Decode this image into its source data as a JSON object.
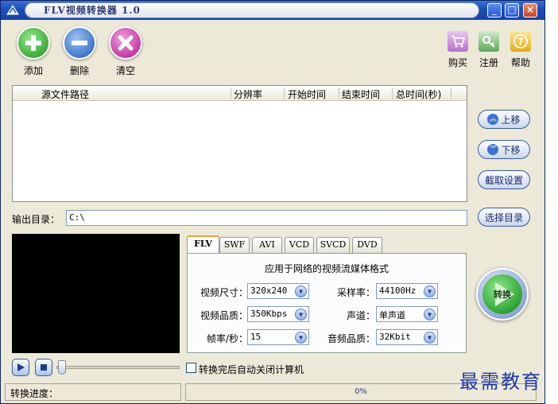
{
  "window": {
    "title": "FLV视频转换器 1.0",
    "minimize": "_",
    "maximize": "□",
    "close": "×"
  },
  "toolbar": {
    "add_label": "添加",
    "delete_label": "删除",
    "clear_label": "清空",
    "buy_label": "购买",
    "register_label": "注册",
    "help_label": "帮助"
  },
  "file_list": {
    "columns": [
      "源文件路径",
      "分辨率",
      "开始时间",
      "结束时间",
      "总时间(秒)"
    ],
    "rows": []
  },
  "side_buttons": {
    "move_up": "上移",
    "move_down": "下移",
    "capture_settings": "截取设置",
    "choose_dir": "选择目录"
  },
  "output": {
    "label": "输出目录：",
    "path": "C:\\"
  },
  "format_tabs": [
    "FLV",
    "SWF",
    "AVI",
    "VCD",
    "SVCD",
    "DVD"
  ],
  "active_tab": "FLV",
  "flv_panel": {
    "description": "应用于网络的视频流媒体格式",
    "video_size_label": "视频尺寸：",
    "video_size": "320x240",
    "video_quality_label": "视频品质：",
    "video_quality": "350Kbps",
    "frame_rate_label": "帧率/秒：",
    "frame_rate": "15",
    "sample_rate_label": "采样率：",
    "sample_rate": "44100Hz",
    "channel_label": "声道：",
    "channel": "单声道",
    "audio_quality_label": "音频品质：",
    "audio_quality": "32Kbit"
  },
  "convert": {
    "label": "转换"
  },
  "player": {
    "seek_position": 0
  },
  "shutdown_checkbox": {
    "label": "转换完后自动关闭计算机",
    "checked": false
  },
  "status": {
    "progress_label": "转换进度：",
    "progress_text": "0%",
    "progress_value": 0
  },
  "watermark": "最需教育",
  "colors": {
    "titlebar": "#1b4db8",
    "window_bg": "#ece9d8",
    "add_green": "#3fae3a",
    "delete_blue": "#3f78d0",
    "clear_magenta": "#c83aa6",
    "convert_green": "#2ea433",
    "watermark_blue": "#2238a6"
  }
}
